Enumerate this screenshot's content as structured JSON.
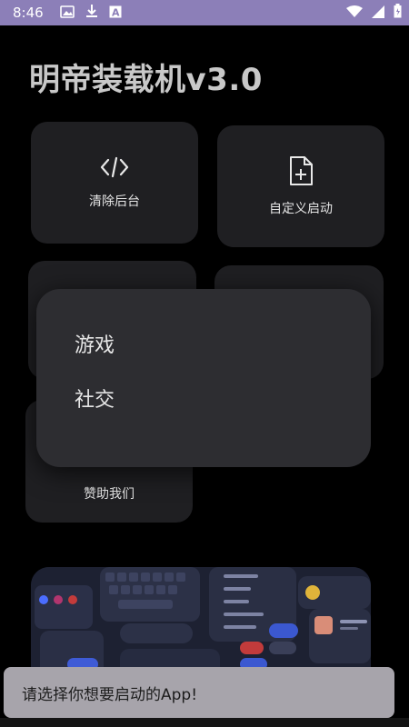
{
  "status_bar": {
    "time": "8:46",
    "icons": [
      "image-icon",
      "download-icon",
      "font-icon"
    ],
    "right_icons": [
      "wifi-icon",
      "signal-icon",
      "battery-icon"
    ]
  },
  "app": {
    "title": "明帝装载机v3.0"
  },
  "cards": {
    "clear_background": {
      "label": "清除后台",
      "icon": "code-icon"
    },
    "custom_launch": {
      "label": "自定义启动",
      "icon": "file-add-icon"
    },
    "sponsor": {
      "label": "赞助我们",
      "icon": "heart-icon"
    }
  },
  "popup": {
    "items": [
      "游戏",
      "社交"
    ]
  },
  "toast": {
    "text": "请选择你想要启动的App!"
  },
  "colors": {
    "status_bar": "#8c7fb8",
    "background": "#000000",
    "card": "#1f1f22",
    "popup": "#2d2d31",
    "toast": "#a7a4ab"
  }
}
